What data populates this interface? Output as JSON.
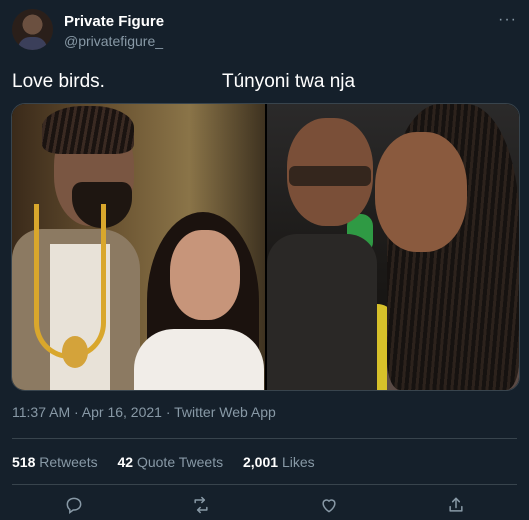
{
  "tweet": {
    "author": {
      "display_name": "Private Figure",
      "handle": "@privatefigure_"
    },
    "more_label": "···",
    "captions": {
      "left": "Love birds.",
      "right": "Túnyoni twa nja"
    },
    "meta": "11:37 AM · Apr 16, 2021 · Twitter Web App",
    "stats": {
      "retweets": {
        "count": "518",
        "label": "Retweets"
      },
      "quotes": {
        "count": "42",
        "label": "Quote Tweets"
      },
      "likes": {
        "count": "2,001",
        "label": "Likes"
      }
    }
  },
  "icons": {
    "reply": "reply-icon",
    "retweet": "retweet-icon",
    "like": "heart-icon",
    "share": "share-icon",
    "more": "more-icon"
  },
  "colors": {
    "background": "#15202b",
    "text_primary": "#ffffff",
    "text_secondary": "#8899a6",
    "divider": "#38444d"
  }
}
